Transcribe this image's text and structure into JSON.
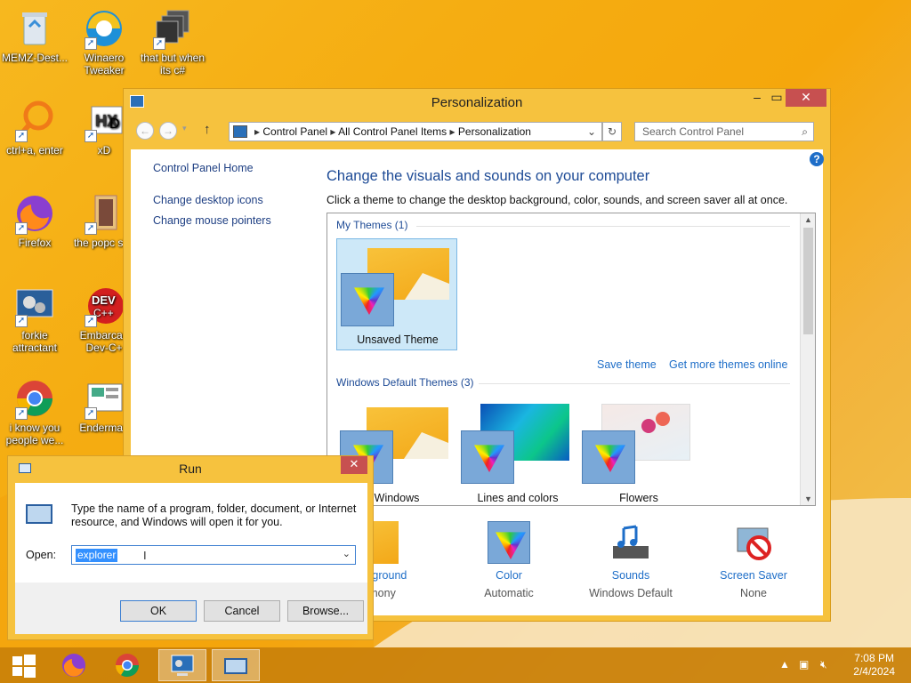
{
  "desktop": {
    "icons": [
      {
        "label": "MEMZ-Dest...",
        "icon": "recycle-bin-icon"
      },
      {
        "label": "Winaero Tweaker",
        "icon": "winaero-icon"
      },
      {
        "label": "that but when its c#",
        "icon": "windows-stack-icon"
      },
      {
        "label": "ctrl+a, enter",
        "icon": "magnifier-icon"
      },
      {
        "label": "xD",
        "icon": "hxd-icon"
      },
      {
        "label": "Firefox",
        "icon": "firefox-icon"
      },
      {
        "label": "the popc shit",
        "icon": "folder-icon"
      },
      {
        "label": "forkie attractant",
        "icon": "settings-monitor-icon"
      },
      {
        "label": "Embarcad Dev-C+",
        "icon": "devcpp-icon"
      },
      {
        "label": "i know you people we...",
        "icon": "chrome-icon"
      },
      {
        "label": "Enderman",
        "icon": "presentation-icon"
      }
    ]
  },
  "personalization": {
    "title": "Personalization",
    "address": {
      "crumbs": [
        "Control Panel",
        "All Control Panel Items",
        "Personalization"
      ],
      "search_placeholder": "Search Control Panel"
    },
    "sidebar": {
      "home": "Control Panel Home",
      "links": [
        "Change desktop icons",
        "Change mouse pointers"
      ]
    },
    "heading": "Change the visuals and sounds on your computer",
    "subheading": "Click a theme to change the desktop background, color, sounds, and screen saver all at once.",
    "my_themes": {
      "label": "My Themes (1)",
      "themes": [
        {
          "name": "Unsaved Theme",
          "selected": true
        }
      ],
      "save_link": "Save theme",
      "more_link": "Get more themes online"
    },
    "default_themes": {
      "label": "Windows Default Themes (3)",
      "themes": [
        {
          "name": "Windows"
        },
        {
          "name": "Lines and colors"
        },
        {
          "name": "Flowers"
        }
      ]
    },
    "bottom": [
      {
        "label": "Background",
        "sub": "armony"
      },
      {
        "label": "Color",
        "sub": "Automatic"
      },
      {
        "label": "Sounds",
        "sub": "Windows Default"
      },
      {
        "label": "Screen Saver",
        "sub": "None"
      }
    ]
  },
  "run": {
    "title": "Run",
    "description": "Type the name of a program, folder, document, or Internet resource, and Windows will open it for you.",
    "open_label": "Open:",
    "value": "explorer",
    "buttons": {
      "ok": "OK",
      "cancel": "Cancel",
      "browse": "Browse..."
    }
  },
  "taskbar": {
    "time": "7:08 PM",
    "date": "2/4/2024"
  }
}
